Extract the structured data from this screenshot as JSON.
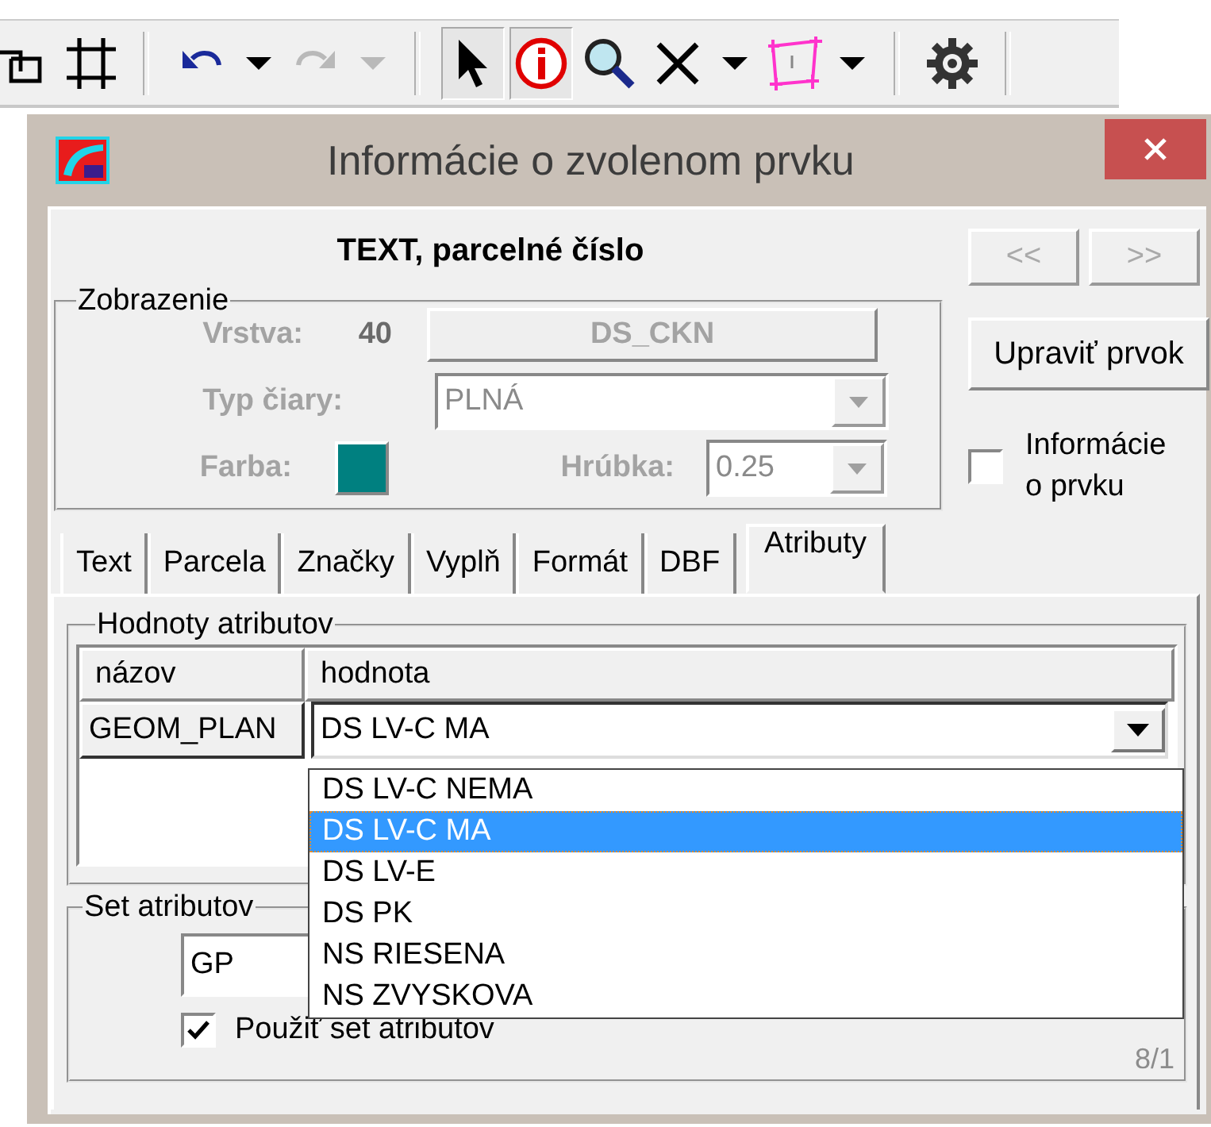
{
  "toolbar": {
    "tools": [
      {
        "kind": "squares",
        "pressed": false,
        "disabled": false
      },
      {
        "kind": "grid",
        "pressed": false,
        "disabled": false
      },
      {
        "kind": "separator"
      },
      {
        "kind": "undo",
        "pressed": false,
        "disabled": false
      },
      {
        "kind": "caret",
        "pressed": false,
        "disabled": false
      },
      {
        "kind": "redo",
        "pressed": false,
        "disabled": true
      },
      {
        "kind": "caret",
        "pressed": false,
        "disabled": true
      },
      {
        "kind": "separator"
      },
      {
        "kind": "pointer",
        "pressed": true,
        "disabled": false
      },
      {
        "kind": "info",
        "pressed": true,
        "disabled": false
      },
      {
        "kind": "magnifier",
        "pressed": false,
        "disabled": false
      },
      {
        "kind": "cross",
        "pressed": false,
        "disabled": false
      },
      {
        "kind": "caret",
        "pressed": false,
        "disabled": false
      },
      {
        "kind": "polygon",
        "pressed": false,
        "disabled": false
      },
      {
        "kind": "caret",
        "pressed": false,
        "disabled": false
      },
      {
        "kind": "separator"
      },
      {
        "kind": "gear",
        "pressed": false,
        "disabled": false
      },
      {
        "kind": "separator"
      }
    ]
  },
  "dialog": {
    "title": "Informácie o zvolenom prvku",
    "heading": "TEXT, parcelné číslo",
    "nav_buttons": [
      {
        "label": "<<",
        "disabled": true
      },
      {
        "label": ">>",
        "disabled": true
      }
    ],
    "edit_button": {
      "label": "Upraviť prvok"
    },
    "info_checkbox": {
      "label": "Informácie o prvku",
      "checked": false
    },
    "display": {
      "title": "Zobrazenie",
      "disabled": true,
      "layer_label": "Vrstva:",
      "layer_number": "40",
      "layer_name": "DS_CKN",
      "line_type_label": "Typ čiary:",
      "line_type": "PLNÁ",
      "color_label": "Farba:",
      "color": "#008080",
      "thickness_label": "Hrúbka:",
      "thickness": "0.25"
    },
    "tabs": [
      {
        "label": "Text",
        "selected": false
      },
      {
        "label": "Parcela",
        "selected": false
      },
      {
        "label": "Značky",
        "selected": false
      },
      {
        "label": "Vyplň",
        "selected": false
      },
      {
        "label": "Formát",
        "selected": false
      },
      {
        "label": "DBF",
        "selected": false
      },
      {
        "label": "Atributy",
        "selected": true
      }
    ],
    "attributes": {
      "title": "Hodnoty atributov",
      "columns": [
        "názov",
        "hodnota"
      ],
      "rows": [
        {
          "name": "GEOM_PLAN",
          "value": "DS LV-C MA",
          "expanded": true
        }
      ],
      "options": [
        {
          "label": "DS LV-C NEMA",
          "selected": false
        },
        {
          "label": "DS LV-C MA",
          "selected": true
        },
        {
          "label": "DS LV-E",
          "selected": false
        },
        {
          "label": "DS PK",
          "selected": false
        },
        {
          "label": "NS RIESENA",
          "selected": false
        },
        {
          "label": "NS ZVYSKOVA",
          "selected": false
        }
      ]
    },
    "attribute_set": {
      "title": "Set atributov",
      "value": "GP",
      "checkbox": {
        "label": "Použiť set atributov",
        "checked": true
      },
      "counter": "8/1"
    }
  }
}
